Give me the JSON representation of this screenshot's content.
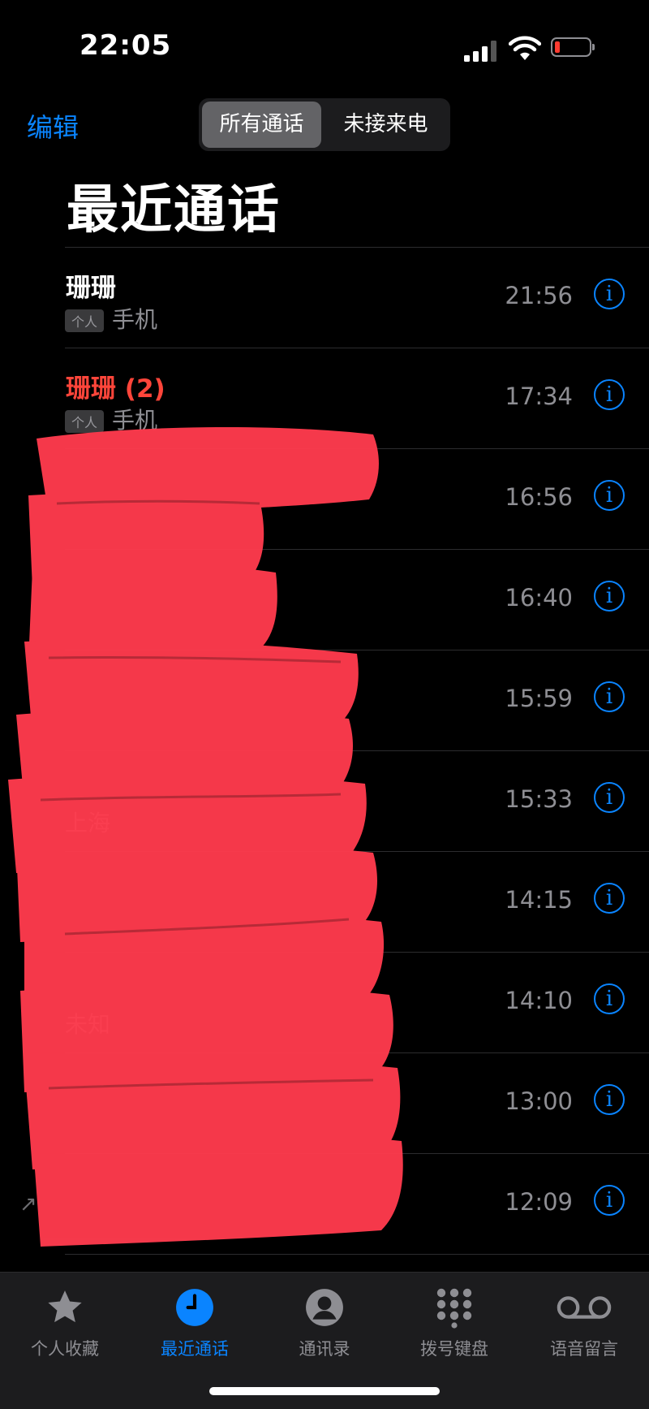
{
  "status_bar": {
    "time": "22:05"
  },
  "nav": {
    "edit_label": "编辑",
    "segments": [
      "所有通话",
      "未接来电"
    ],
    "title": "最近通话"
  },
  "calls": [
    {
      "name": "珊珊",
      "missed": false,
      "badge": "个人",
      "label": "手机",
      "time": "21:56"
    },
    {
      "name": "珊珊 (2)",
      "missed": true,
      "badge": "个人",
      "label": "手机",
      "time": "17:34"
    },
    {
      "name": "",
      "missed": false,
      "badge": "",
      "label": "",
      "time": "16:56"
    },
    {
      "name": "",
      "missed": false,
      "badge": "",
      "label": "",
      "time": "16:40"
    },
    {
      "name": "",
      "missed": false,
      "badge": "",
      "label": "",
      "time": "15:59"
    },
    {
      "name": "",
      "missed": false,
      "badge": "",
      "label": "上海",
      "time": "15:33"
    },
    {
      "name": "",
      "missed": false,
      "badge": "",
      "label": "",
      "time": "14:15"
    },
    {
      "name": "",
      "missed": false,
      "badge": "",
      "label": "未知",
      "time": "14:10"
    },
    {
      "name": "",
      "missed": false,
      "badge": "",
      "label": "",
      "time": "13:00"
    },
    {
      "name": "",
      "missed": false,
      "badge": "",
      "label": "",
      "time": "12:09"
    }
  ],
  "tabbar": {
    "tabs": [
      {
        "label": "个人收藏",
        "icon": "star-icon",
        "active": false
      },
      {
        "label": "最近通话",
        "icon": "clock-icon",
        "active": true
      },
      {
        "label": "通讯录",
        "icon": "contact-icon",
        "active": false
      },
      {
        "label": "拨号键盘",
        "icon": "keypad-icon",
        "active": false
      },
      {
        "label": "语音留言",
        "icon": "voicemail-icon",
        "active": false
      }
    ]
  },
  "colors": {
    "accent": "#0a84ff",
    "missed": "#ff453a",
    "redaction": "#ff3b4e",
    "battery_low": "#ff3b30"
  }
}
